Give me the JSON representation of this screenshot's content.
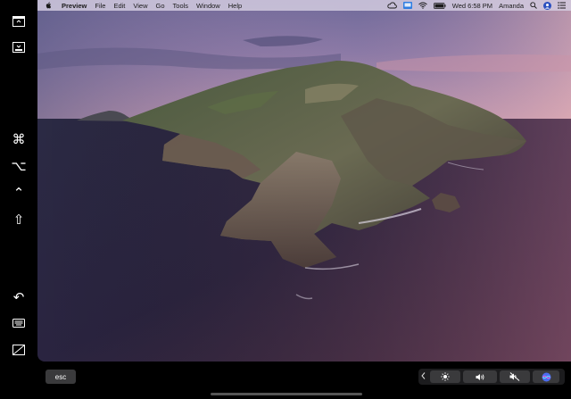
{
  "menubar": {
    "items": [
      "Preview",
      "File",
      "Edit",
      "View",
      "Go",
      "Tools",
      "Window",
      "Help"
    ],
    "clock": "Wed 6:58 PM",
    "user": "Amanda",
    "status_icons": [
      "creative-cloud-icon",
      "display-icon",
      "wifi-icon",
      "battery-icon",
      "search-icon",
      "user-avatar-icon",
      "menu-list-icon"
    ]
  },
  "sidebar": {
    "buttons": [
      "show-menubar-icon",
      "show-dock-icon",
      "command-key-icon",
      "option-key-icon",
      "control-key-icon",
      "shift-key-icon",
      "undo-icon",
      "keyboard-icon",
      "disconnect-icon"
    ],
    "glyphs": {
      "command": "⌘",
      "option": "⌥",
      "control": "⌃",
      "shift": "⇧",
      "undo": "↶"
    }
  },
  "touchbar": {
    "esc_label": "esc",
    "strip_icons": [
      "chevron-left-icon",
      "brightness-icon",
      "volume-icon",
      "mute-icon",
      "siri-icon"
    ]
  },
  "colors": {
    "menubar_bg": "#d6cee2",
    "siri_accent": "#4b6cf0"
  }
}
